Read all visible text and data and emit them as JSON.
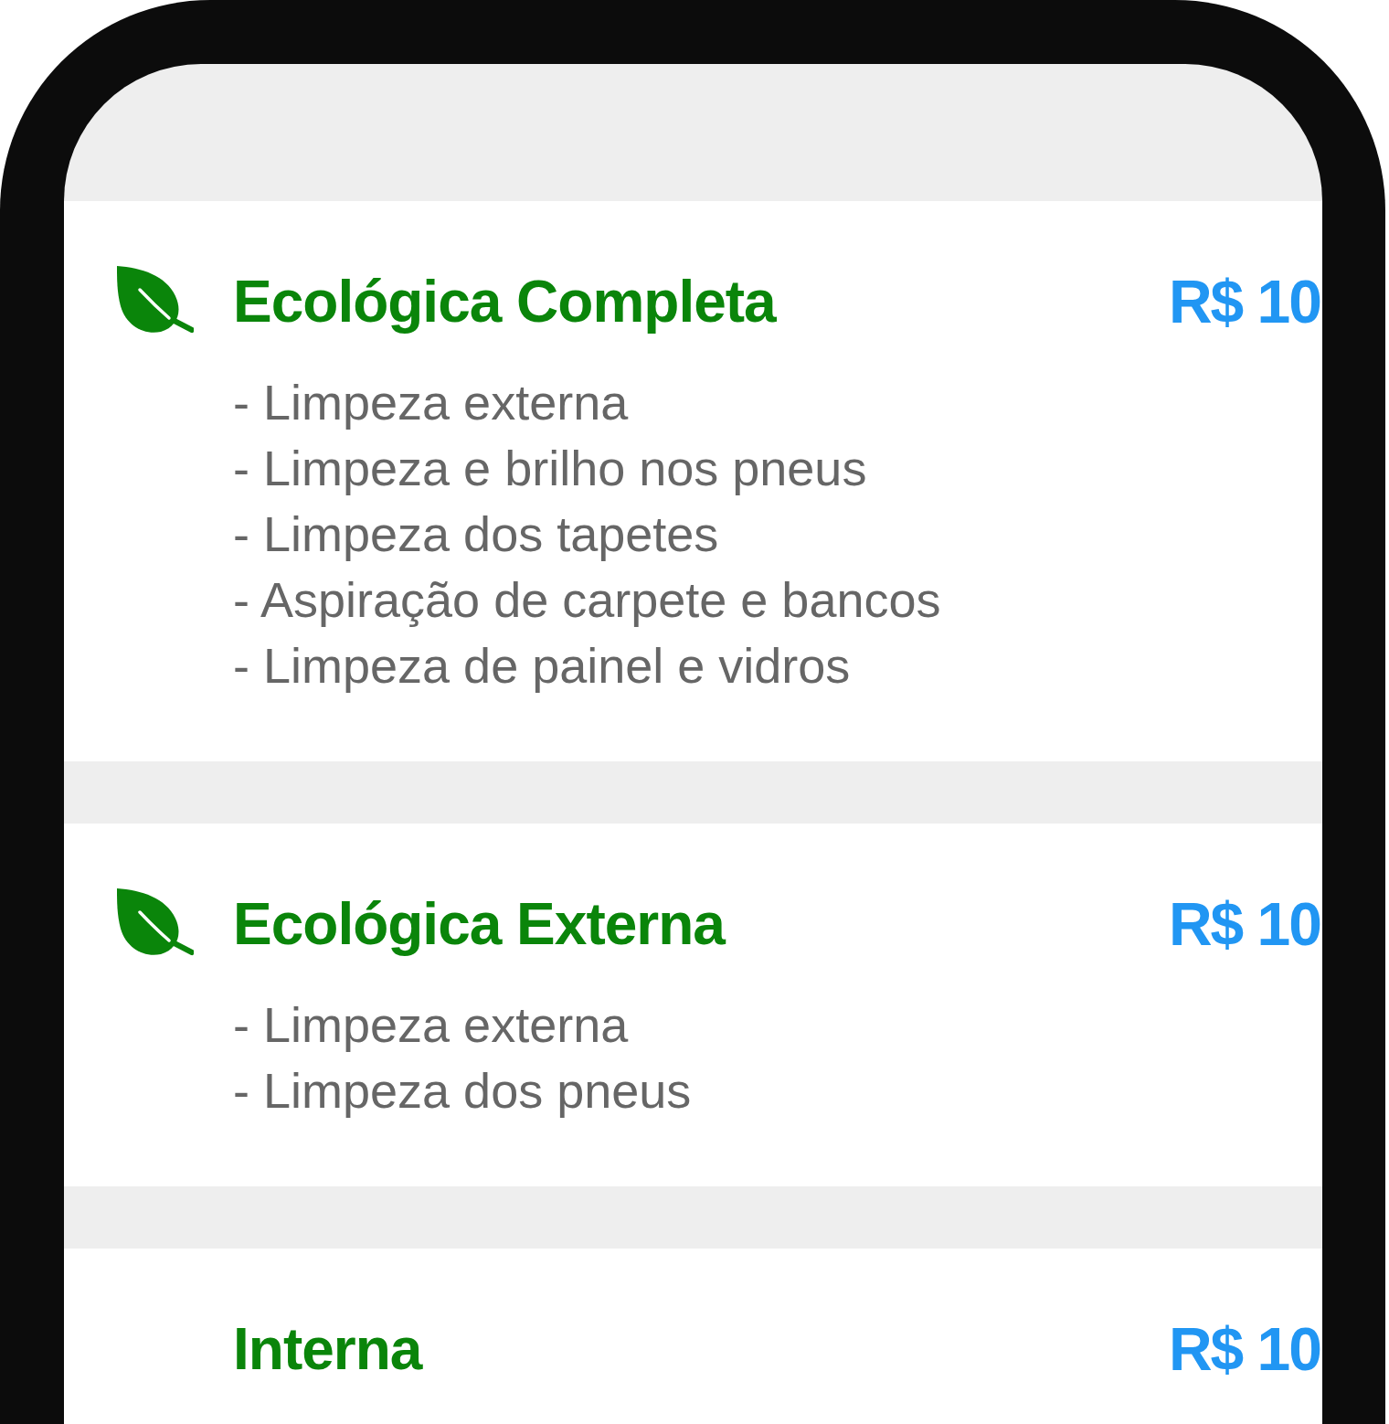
{
  "services": [
    {
      "eco": true,
      "title": "Ecológica Completa",
      "price": "R$ 10",
      "features": [
        "- Limpeza externa",
        "- Limpeza e brilho nos pneus",
        "- Limpeza dos tapetes",
        "- Aspiração de carpete e bancos",
        "- Limpeza de painel e vidros"
      ]
    },
    {
      "eco": true,
      "title": "Ecológica Externa",
      "price": "R$ 10",
      "features": [
        "- Limpeza externa",
        "- Limpeza dos pneus"
      ]
    },
    {
      "eco": false,
      "title": "Interna",
      "price": "R$ 10"
    }
  ]
}
